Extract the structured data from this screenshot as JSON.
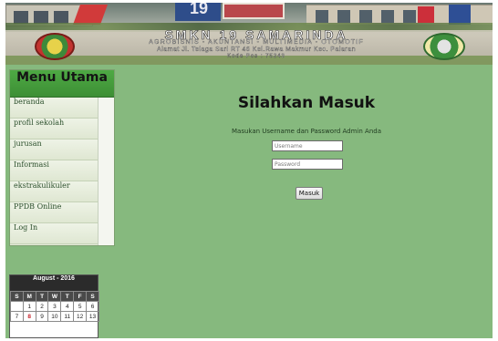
{
  "header": {
    "school_name": "SMKN 19 SAMARINDA",
    "majors": "AGROBISNIS - AKUNTANSI - MULTIMEDIA - OTOMOTIF",
    "address": "Alamat Jl. Telaga Sari RT 46 Kel.Rawa Makmur Kec. Palaran",
    "address_line2": "Kode Pos : 75243"
  },
  "sidebar": {
    "title": "Menu Utama",
    "items": [
      {
        "label": "beranda"
      },
      {
        "label": "profil sekolah"
      },
      {
        "label": "jurusan"
      },
      {
        "label": "Informasi"
      },
      {
        "label": "ekstrakulikuler"
      },
      {
        "label": "PPDB Online"
      },
      {
        "label": "Log In"
      }
    ]
  },
  "calendar": {
    "month": "August - 2016",
    "weekdays": [
      "S",
      "M",
      "T",
      "W",
      "T",
      "F",
      "S"
    ],
    "rows": [
      [
        "",
        "1",
        "2",
        "3",
        "4",
        "5",
        "6"
      ],
      [
        "7",
        "8",
        "9",
        "10",
        "11",
        "12",
        "13"
      ]
    ],
    "today": "8"
  },
  "login": {
    "title": "Silahkan Masuk",
    "subtitle": "Masukan Username dan Password Admin Anda",
    "username_placeholder": "Username",
    "password_placeholder": "Password",
    "submit_label": "Masuk"
  },
  "colors": {
    "page_background": "#86b97e",
    "menu_header": "#3d8f35",
    "menu_text": "#2b4f2b",
    "calendar_header": "#2b2b2b",
    "today_highlight": "#c8232c"
  }
}
